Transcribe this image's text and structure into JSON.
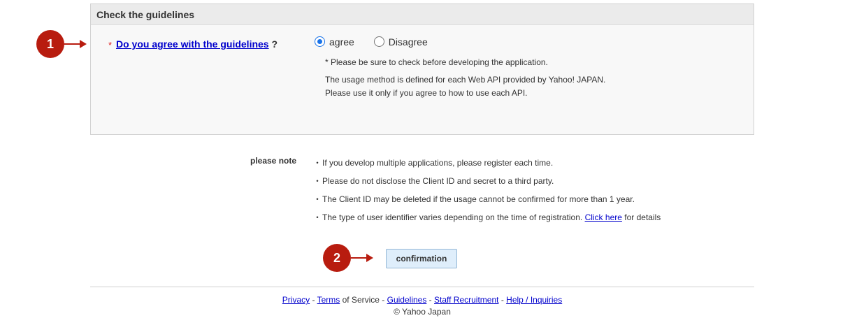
{
  "panel": {
    "title": "Check the guidelines",
    "required_mark": "*",
    "question_link": "Do you agree with the guidelines",
    "question_suffix": "?",
    "options": {
      "agree": "agree",
      "disagree": "Disagree",
      "selected": "agree"
    },
    "notes": [
      "* Please be sure to check before developing the application.",
      "The usage method is defined for each Web API provided by Yahoo! JAPAN.",
      "Please use it only if you agree to how to use each API."
    ]
  },
  "markers": {
    "one": "1",
    "two": "2"
  },
  "please_note": {
    "label": "please note",
    "bullet": "・",
    "items": [
      "If you develop multiple applications, please register each time.",
      "Please do not disclose the Client ID and secret to a third party.",
      "The Client ID may be deleted if the usage cannot be confirmed for more than 1 year.",
      "The type of user identifier varies depending on the time of registration."
    ],
    "link_text": "Click here",
    "link_suffix": "for details"
  },
  "confirm_label": "confirmation",
  "footer": {
    "privacy": "Privacy",
    "terms": "Terms",
    "of_service": "of Service -",
    "guidelines": "Guidelines",
    "staff": "Staff Recruitment",
    "help": "Help / Inquiries",
    "copyright": "© Yahoo Japan"
  },
  "colors": {
    "marker": "#b81c0f",
    "link": "#0000cc",
    "button_bg": "#dfeefb",
    "radio_accent": "#1a73e8"
  }
}
